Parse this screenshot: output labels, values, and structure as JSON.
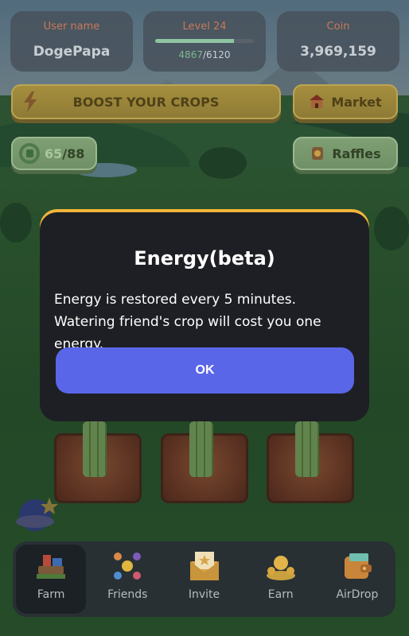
{
  "stats": {
    "user": {
      "label": "User name",
      "value": "DogePapa"
    },
    "level": {
      "label": "Level 24",
      "current": "4867",
      "total": "/6120",
      "progress": 0.795
    },
    "coin": {
      "label": "Coin",
      "value": "3,969,159"
    }
  },
  "actions": {
    "boost": "BOOST YOUR CROPS",
    "market": "Market",
    "energy_current": "65",
    "energy_total": "/88",
    "raffles": "Raffles"
  },
  "modal": {
    "title": "Energy(beta)",
    "body": "Energy is restored every 5 minutes. Watering friend's crop will cost you one energy.",
    "ok": "OK"
  },
  "nav": [
    {
      "label": "Farm",
      "icon": "tractor-icon",
      "active": true
    },
    {
      "label": "Friends",
      "icon": "friends-icon",
      "active": false
    },
    {
      "label": "Invite",
      "icon": "envelope-icon",
      "active": false
    },
    {
      "label": "Earn",
      "icon": "coins-icon",
      "active": false
    },
    {
      "label": "AirDrop",
      "icon": "wallet-icon",
      "active": false
    }
  ],
  "colors": {
    "accent": "#5a66e8",
    "modal_border": "#f1b43a",
    "label": "#c7795a"
  }
}
